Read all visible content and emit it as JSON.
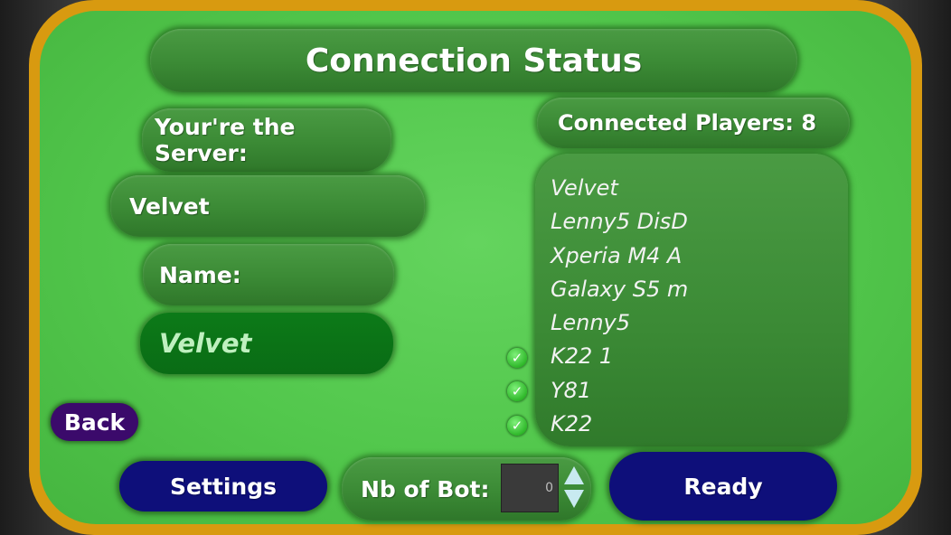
{
  "title": "Connection Status",
  "server": {
    "label": "Your're the Server:",
    "name": "Velvet"
  },
  "name_field": {
    "label": "Name:",
    "value": "Velvet"
  },
  "players": {
    "label": "Connected Players: 8",
    "list": [
      {
        "name": "Velvet",
        "ready": false
      },
      {
        "name": "Lenny5 DisD",
        "ready": false
      },
      {
        "name": "Xperia M4 A",
        "ready": false
      },
      {
        "name": "Galaxy S5 m",
        "ready": false
      },
      {
        "name": "Lenny5",
        "ready": false
      },
      {
        "name": "K22 1",
        "ready": true
      },
      {
        "name": "Y81",
        "ready": true
      },
      {
        "name": "K22",
        "ready": true
      }
    ]
  },
  "buttons": {
    "back": "Back",
    "settings": "Settings",
    "ready": "Ready"
  },
  "bots": {
    "label": "Nb of Bot:",
    "value": "0"
  },
  "colors": {
    "frame": "#d89a10",
    "field": "#52c74c",
    "panel": "#3b8a35",
    "name_input": "#0a6c15",
    "back_button": "#3b0a6b",
    "blue_button": "#0e0f7a"
  }
}
